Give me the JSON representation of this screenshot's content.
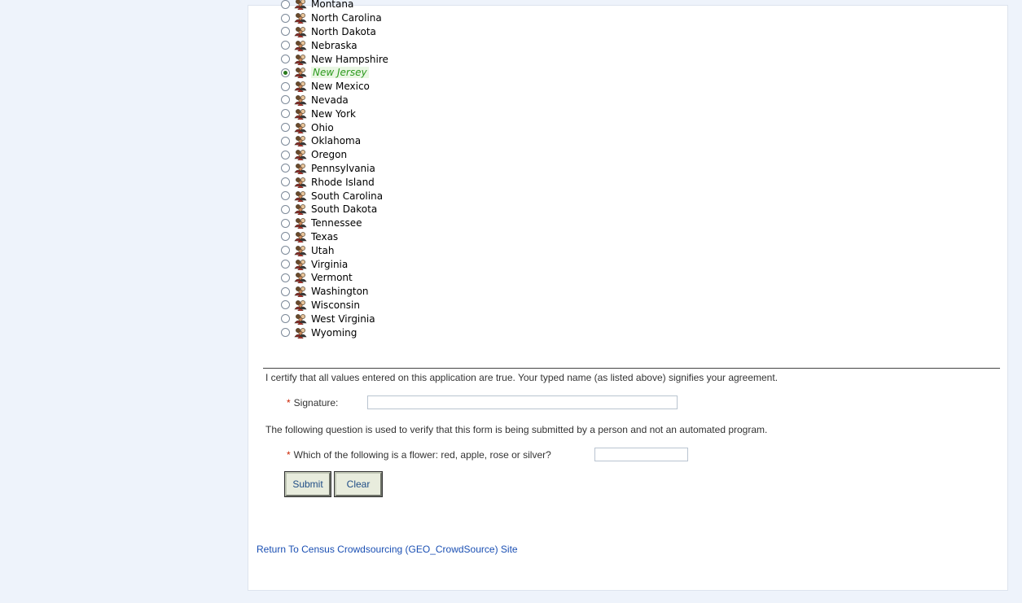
{
  "states": [
    {
      "name": "Montana",
      "selected": false
    },
    {
      "name": "North Carolina",
      "selected": false
    },
    {
      "name": "North Dakota",
      "selected": false
    },
    {
      "name": "Nebraska",
      "selected": false
    },
    {
      "name": "New Hampshire",
      "selected": false
    },
    {
      "name": "New Jersey",
      "selected": true
    },
    {
      "name": "New Mexico",
      "selected": false
    },
    {
      "name": "Nevada",
      "selected": false
    },
    {
      "name": "New York",
      "selected": false
    },
    {
      "name": "Ohio",
      "selected": false
    },
    {
      "name": "Oklahoma",
      "selected": false
    },
    {
      "name": "Oregon",
      "selected": false
    },
    {
      "name": "Pennsylvania",
      "selected": false
    },
    {
      "name": "Rhode Island",
      "selected": false
    },
    {
      "name": "South Carolina",
      "selected": false
    },
    {
      "name": "South Dakota",
      "selected": false
    },
    {
      "name": "Tennessee",
      "selected": false
    },
    {
      "name": "Texas",
      "selected": false
    },
    {
      "name": "Utah",
      "selected": false
    },
    {
      "name": "Virginia",
      "selected": false
    },
    {
      "name": "Vermont",
      "selected": false
    },
    {
      "name": "Washington",
      "selected": false
    },
    {
      "name": "Wisconsin",
      "selected": false
    },
    {
      "name": "West Virginia",
      "selected": false
    },
    {
      "name": "Wyoming",
      "selected": false
    }
  ],
  "state_icon": "people-group-icon",
  "certification": {
    "text": "I certify that all values entered on this application are true. Your typed name (as listed above) signifies your agreement.",
    "required_marker": "*",
    "signature_label": "Signature:",
    "signature_value": ""
  },
  "verification": {
    "text": "The following question is used to verify that this form is being submitted by a person and not an automated program.",
    "required_marker": "*",
    "question_label": "Which of the following is a flower: red, apple, rose or silver?",
    "answer_value": ""
  },
  "buttons": {
    "submit_label": "Submit",
    "clear_label": "Clear"
  },
  "footer": {
    "return_link": "Return To Census Crowdsourcing (GEO_CrowdSource) Site"
  },
  "colors": {
    "page_bg": "#eef3fb",
    "selected_text": "#2e9b1f",
    "required": "#cc2200",
    "link": "#1a4fb3"
  }
}
